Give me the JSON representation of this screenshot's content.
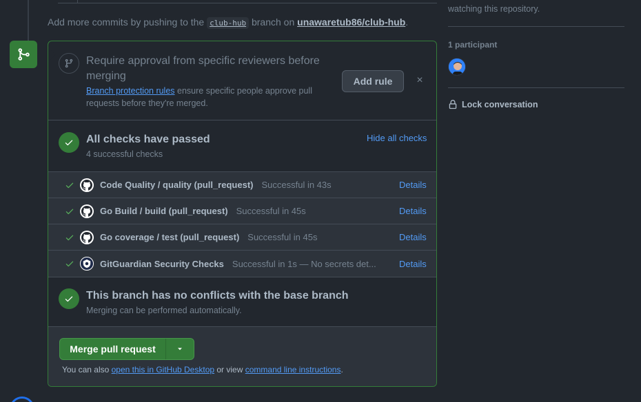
{
  "timeline": {
    "add_commits_prefix": "Add more commits by pushing to the ",
    "branch_name": "club-hub",
    "add_commits_mid": " branch on ",
    "repo_branch": "unawaretub86/club-hub",
    "add_commits_suffix": "."
  },
  "approval": {
    "title": "Require approval from specific reviewers before merging",
    "link_text": "Branch protection rules",
    "desc_text": " ensure specific people approve pull requests before they're merged.",
    "add_rule_label": "Add rule",
    "close_symbol": "×"
  },
  "checks": {
    "title": "All checks have passed",
    "subtitle": "4 successful checks",
    "hide_label": "Hide all checks",
    "rows": [
      {
        "name": "Code Quality / quality (pull_request)",
        "status": "Successful in 43s",
        "details": "Details",
        "icon": "github-icon"
      },
      {
        "name": "Go Build / build (pull_request)",
        "status": "Successful in 45s",
        "details": "Details",
        "icon": "github-icon"
      },
      {
        "name": "Go coverage / test (pull_request)",
        "status": "Successful in 45s",
        "details": "Details",
        "icon": "github-icon"
      },
      {
        "name": "GitGuardian Security Checks",
        "status": "Successful in 1s — No secrets det...",
        "details": "Details",
        "icon": "gitguardian-icon"
      }
    ]
  },
  "conflicts": {
    "title": "This branch has no conflicts with the base branch",
    "subtitle": "Merging can be performed automatically."
  },
  "merge": {
    "button_label": "Merge pull request",
    "also_prefix": "You can also ",
    "desktop_link": "open this in GitHub Desktop",
    "also_mid": " or view ",
    "cli_link": "command line instructions",
    "also_suffix": "."
  },
  "sidebar": {
    "watching_text": "watching this repository.",
    "participants_label": "1 participant",
    "lock_label": "Lock conversation"
  },
  "colors": {
    "background": "#22272e",
    "success_green": "#347d39",
    "link_blue": "#539bf5",
    "muted_text": "#768390"
  }
}
